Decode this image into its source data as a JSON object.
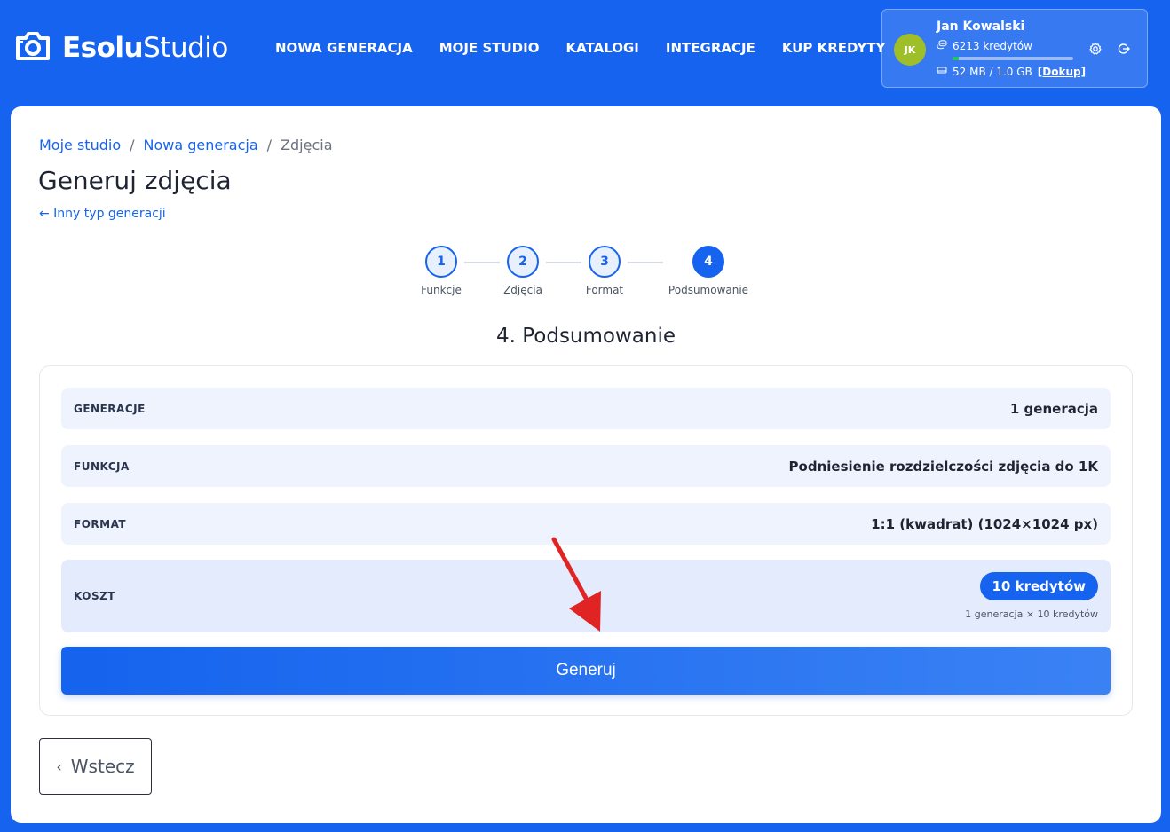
{
  "header": {
    "logo_bold": "Esolu",
    "logo_light": "Studio",
    "nav": [
      {
        "label": "NOWA GENERACJA"
      },
      {
        "label": "MOJE STUDIO"
      },
      {
        "label": "KATALOGI"
      },
      {
        "label": "INTEGRACJE"
      },
      {
        "label": "KUP KREDYTY"
      }
    ],
    "user": {
      "initials": "JK",
      "name": "Jan Kowalski",
      "credits": "6213 kredytów",
      "storage": "52 MB / 1.0 GB",
      "storage_fraction": 0.05,
      "topup_label": "[Dokup]"
    }
  },
  "breadcrumb": {
    "items": [
      "Moje studio",
      "Nowa generacja"
    ],
    "separator": "/",
    "current": "Zdjęcia"
  },
  "page": {
    "title": "Generuj zdjęcia",
    "back_link": "← Inny typ generacji"
  },
  "stepper": {
    "steps": [
      {
        "number": "1",
        "label": "Funkcje"
      },
      {
        "number": "2",
        "label": "Zdjęcia"
      },
      {
        "number": "3",
        "label": "Format"
      },
      {
        "number": "4",
        "label": "Podsumowanie"
      }
    ],
    "active_step": 4
  },
  "summary": {
    "title": "4. Podsumowanie",
    "rows": [
      {
        "label": "GENERACJE",
        "value": "1 generacja"
      },
      {
        "label": "FUNKCJA",
        "value": "Podniesienie rozdzielczości zdjęcia do 1K"
      },
      {
        "label": "FORMAT",
        "value": "1:1 (kwadrat) (1024×1024 px)"
      }
    ],
    "cost": {
      "label": "KOSZT",
      "badge": "10 kredytów",
      "note": "1 generacja × 10 kredytów"
    },
    "generate_button": "Generuj"
  },
  "footer": {
    "back_button": "Wstecz",
    "back_chevron": "‹"
  },
  "colors": {
    "brand": "#1563ee",
    "annotation_arrow": "#e02424"
  }
}
